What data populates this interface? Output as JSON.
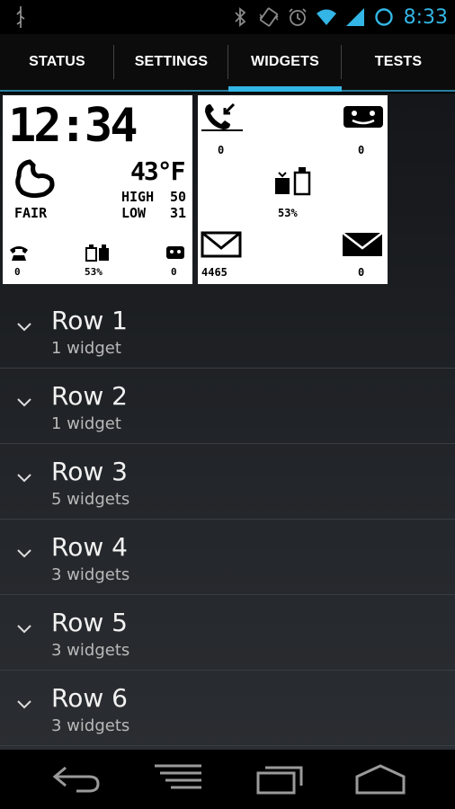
{
  "status_bar": {
    "time": "8:33",
    "icons": [
      "usb-debug-icon",
      "bluetooth-icon",
      "vibrate-icon",
      "alarm-icon",
      "wifi-icon",
      "signal-icon",
      "battery-icon"
    ]
  },
  "tabs": [
    {
      "label": "STATUS",
      "active": false
    },
    {
      "label": "SETTINGS",
      "active": false
    },
    {
      "label": "WIDGETS",
      "active": true
    },
    {
      "label": "TESTS",
      "active": false
    }
  ],
  "widget_preview_1": {
    "time": "12:34",
    "temperature": "43°F",
    "condition": "FAIR",
    "high_label": "HIGH",
    "high_value": "50",
    "low_label": "LOW",
    "low_value": "31",
    "phone_count": "0",
    "battery_percent": "53%",
    "sms_count": "0"
  },
  "widget_preview_2": {
    "missed_calls": "0",
    "sms_count": "0",
    "battery_percent": "53%",
    "email_count": "4465",
    "mail_count": "0"
  },
  "rows": [
    {
      "title": "Row 1",
      "subtitle": "1 widget"
    },
    {
      "title": "Row 2",
      "subtitle": "1 widget"
    },
    {
      "title": "Row 3",
      "subtitle": "5 widgets"
    },
    {
      "title": "Row 4",
      "subtitle": "3 widgets"
    },
    {
      "title": "Row 5",
      "subtitle": "3 widgets"
    },
    {
      "title": "Row 6",
      "subtitle": "3 widgets"
    }
  ],
  "navigation": [
    "back-icon",
    "menu-icon",
    "recent-apps-icon",
    "home-icon"
  ],
  "colors": {
    "accent": "#33b5e5",
    "background": "#000000"
  }
}
